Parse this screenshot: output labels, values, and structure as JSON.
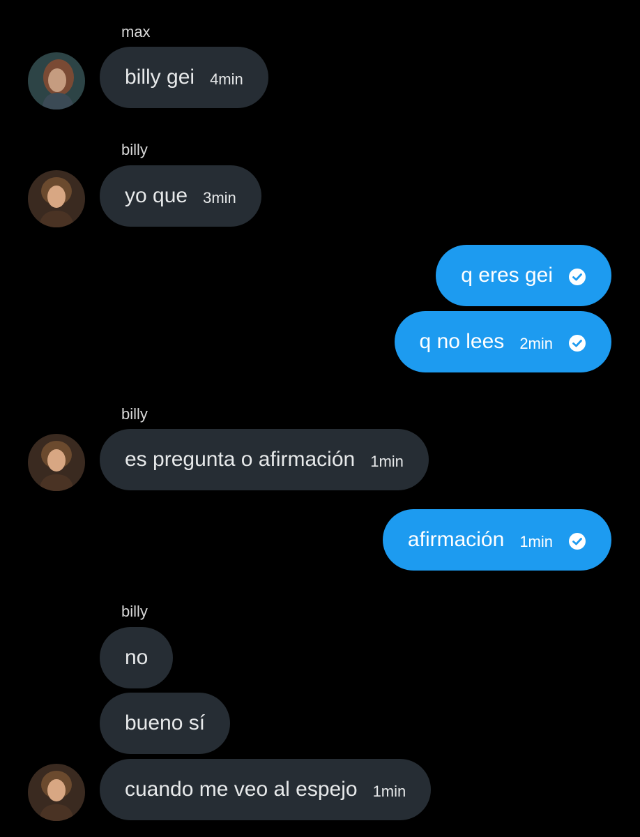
{
  "colors": {
    "background": "#000000",
    "incoming_bubble": "#262d34",
    "outgoing_bubble": "#1d9bf0",
    "text_light": "#e7e9ea"
  },
  "groups": [
    {
      "sender": "max",
      "messages": [
        {
          "text": "billy gei",
          "time": "4min"
        }
      ]
    },
    {
      "sender": "billy",
      "messages": [
        {
          "text": "yo que",
          "time": "3min"
        }
      ]
    },
    {
      "sender": "",
      "messages": [
        {
          "text": "q eres gei",
          "time": "",
          "status_icon": "check-circle-icon"
        },
        {
          "text": "q no lees",
          "time": "2min",
          "status_icon": "check-circle-icon"
        }
      ]
    },
    {
      "sender": "billy",
      "messages": [
        {
          "text": "es pregunta o afirmación",
          "time": "1min"
        }
      ]
    },
    {
      "sender": "",
      "messages": [
        {
          "text": "afirmación",
          "time": "1min",
          "status_icon": "check-circle-icon"
        }
      ]
    },
    {
      "sender": "billy",
      "messages": [
        {
          "text": "no",
          "time": ""
        },
        {
          "text": "bueno sí",
          "time": ""
        },
        {
          "text": "cuando me veo al espejo",
          "time": "1min"
        }
      ]
    }
  ]
}
